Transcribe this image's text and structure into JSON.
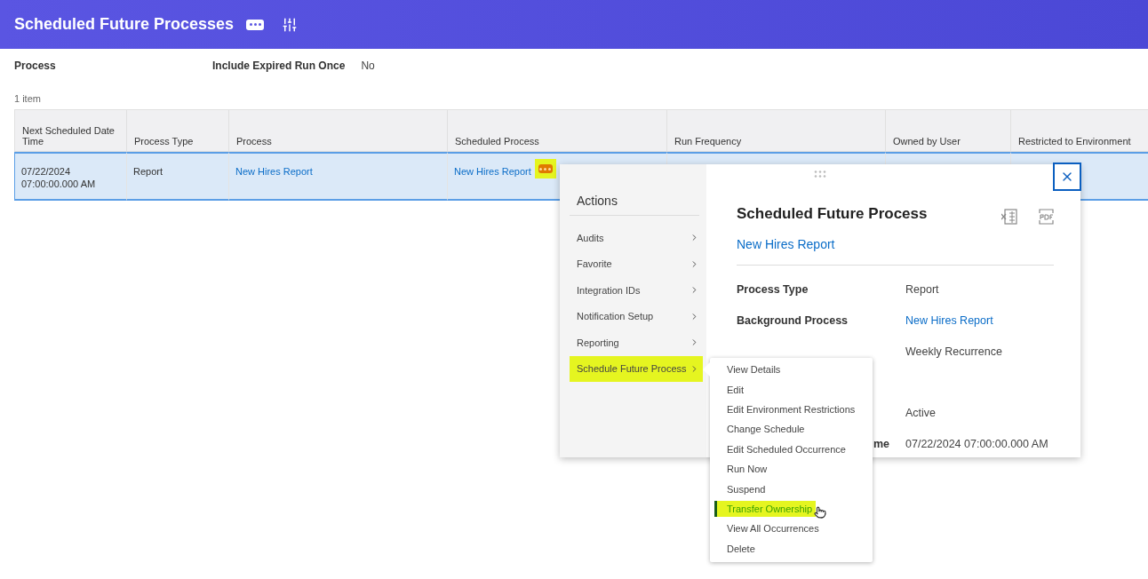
{
  "header": {
    "title": "Scheduled Future Processes"
  },
  "filters": [
    {
      "label": "Process"
    },
    {
      "label": "Include Expired Run Once",
      "value": "No"
    }
  ],
  "item_count": "1 item",
  "table": {
    "columns": [
      "Next Scheduled Date Time",
      "Process Type",
      "Process",
      "Scheduled Process",
      "Run Frequency",
      "Owned by User",
      "Restricted to Environment"
    ],
    "rows": [
      {
        "selected": true,
        "cells": [
          {
            "kind": "text",
            "text": "07/22/2024 07:00:00.000 AM"
          },
          {
            "kind": "text",
            "text": "Report"
          },
          {
            "kind": "link",
            "text": "New Hires Report"
          },
          {
            "kind": "link",
            "text": "New Hires Report",
            "related_actions": {
              "highlighted": true
            }
          }
        ]
      }
    ]
  },
  "actions_menu": {
    "title": "Actions",
    "items": [
      {
        "label": "Audits",
        "highlighted": false
      },
      {
        "label": "Favorite",
        "highlighted": false
      },
      {
        "label": "Integration IDs",
        "highlighted": false
      },
      {
        "label": "Notification Setup",
        "highlighted": false
      },
      {
        "label": "Reporting",
        "highlighted": false
      },
      {
        "label": "Schedule Future Process",
        "highlighted": true
      }
    ]
  },
  "submenu": {
    "items": [
      {
        "label": "View Details",
        "highlighted": false
      },
      {
        "label": "Edit",
        "highlighted": false
      },
      {
        "label": "Edit Environment Restrictions",
        "highlighted": false
      },
      {
        "label": "Change Schedule",
        "highlighted": false
      },
      {
        "label": "Edit Scheduled Occurrence",
        "highlighted": false
      },
      {
        "label": "Run Now",
        "highlighted": false
      },
      {
        "label": "Suspend",
        "highlighted": false
      },
      {
        "label": "Transfer Ownership",
        "highlighted": true
      },
      {
        "label": "View All Occurrences",
        "highlighted": false
      },
      {
        "label": "Delete",
        "highlighted": false
      }
    ]
  },
  "detail": {
    "title": "Scheduled Future Process",
    "subtitle": "New Hires Report",
    "fields": [
      {
        "label": "Process Type",
        "value": "Report",
        "kind": "text"
      },
      {
        "label": "Background Process",
        "value": "New Hires Report",
        "kind": "link"
      },
      {
        "value": "Weekly Recurrence",
        "kind": "text"
      },
      {
        "value": "Active",
        "kind": "text"
      },
      {
        "label": "me",
        "value": "07/22/2024 07:00:00.000 AM",
        "kind": "text"
      }
    ]
  }
}
